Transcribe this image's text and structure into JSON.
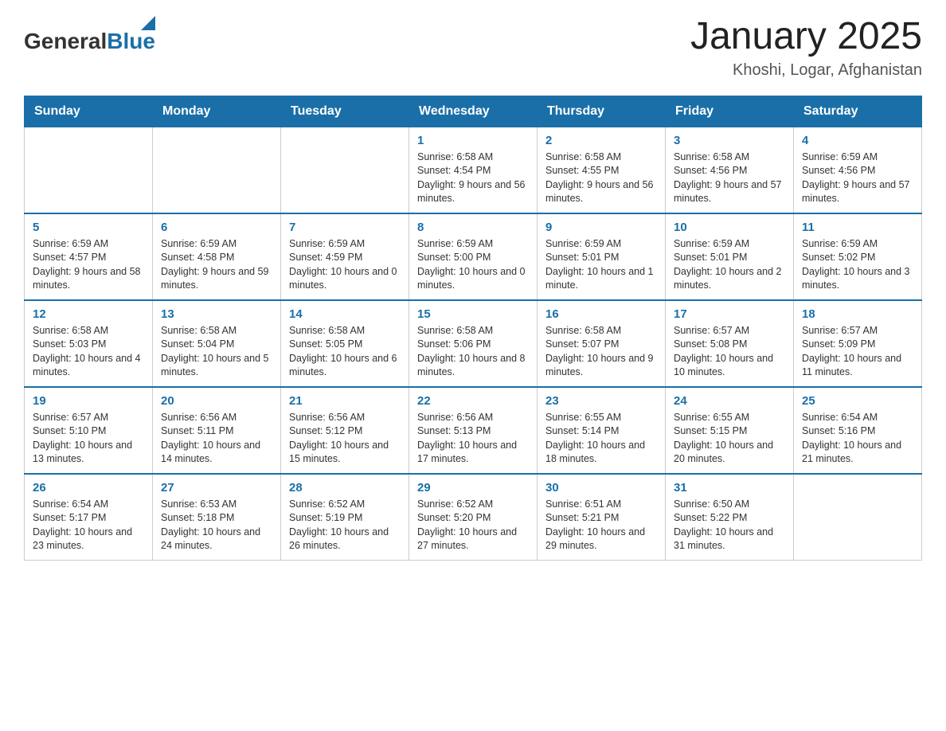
{
  "header": {
    "logo_general": "General",
    "logo_blue": "Blue",
    "title": "January 2025",
    "subtitle": "Khoshi, Logar, Afghanistan"
  },
  "days_of_week": [
    "Sunday",
    "Monday",
    "Tuesday",
    "Wednesday",
    "Thursday",
    "Friday",
    "Saturday"
  ],
  "weeks": [
    [
      {
        "day": "",
        "info": ""
      },
      {
        "day": "",
        "info": ""
      },
      {
        "day": "",
        "info": ""
      },
      {
        "day": "1",
        "info": "Sunrise: 6:58 AM\nSunset: 4:54 PM\nDaylight: 9 hours\nand 56 minutes."
      },
      {
        "day": "2",
        "info": "Sunrise: 6:58 AM\nSunset: 4:55 PM\nDaylight: 9 hours\nand 56 minutes."
      },
      {
        "day": "3",
        "info": "Sunrise: 6:58 AM\nSunset: 4:56 PM\nDaylight: 9 hours\nand 57 minutes."
      },
      {
        "day": "4",
        "info": "Sunrise: 6:59 AM\nSunset: 4:56 PM\nDaylight: 9 hours\nand 57 minutes."
      }
    ],
    [
      {
        "day": "5",
        "info": "Sunrise: 6:59 AM\nSunset: 4:57 PM\nDaylight: 9 hours\nand 58 minutes."
      },
      {
        "day": "6",
        "info": "Sunrise: 6:59 AM\nSunset: 4:58 PM\nDaylight: 9 hours\nand 59 minutes."
      },
      {
        "day": "7",
        "info": "Sunrise: 6:59 AM\nSunset: 4:59 PM\nDaylight: 10 hours\nand 0 minutes."
      },
      {
        "day": "8",
        "info": "Sunrise: 6:59 AM\nSunset: 5:00 PM\nDaylight: 10 hours\nand 0 minutes."
      },
      {
        "day": "9",
        "info": "Sunrise: 6:59 AM\nSunset: 5:01 PM\nDaylight: 10 hours\nand 1 minute."
      },
      {
        "day": "10",
        "info": "Sunrise: 6:59 AM\nSunset: 5:01 PM\nDaylight: 10 hours\nand 2 minutes."
      },
      {
        "day": "11",
        "info": "Sunrise: 6:59 AM\nSunset: 5:02 PM\nDaylight: 10 hours\nand 3 minutes."
      }
    ],
    [
      {
        "day": "12",
        "info": "Sunrise: 6:58 AM\nSunset: 5:03 PM\nDaylight: 10 hours\nand 4 minutes."
      },
      {
        "day": "13",
        "info": "Sunrise: 6:58 AM\nSunset: 5:04 PM\nDaylight: 10 hours\nand 5 minutes."
      },
      {
        "day": "14",
        "info": "Sunrise: 6:58 AM\nSunset: 5:05 PM\nDaylight: 10 hours\nand 6 minutes."
      },
      {
        "day": "15",
        "info": "Sunrise: 6:58 AM\nSunset: 5:06 PM\nDaylight: 10 hours\nand 8 minutes."
      },
      {
        "day": "16",
        "info": "Sunrise: 6:58 AM\nSunset: 5:07 PM\nDaylight: 10 hours\nand 9 minutes."
      },
      {
        "day": "17",
        "info": "Sunrise: 6:57 AM\nSunset: 5:08 PM\nDaylight: 10 hours\nand 10 minutes."
      },
      {
        "day": "18",
        "info": "Sunrise: 6:57 AM\nSunset: 5:09 PM\nDaylight: 10 hours\nand 11 minutes."
      }
    ],
    [
      {
        "day": "19",
        "info": "Sunrise: 6:57 AM\nSunset: 5:10 PM\nDaylight: 10 hours\nand 13 minutes."
      },
      {
        "day": "20",
        "info": "Sunrise: 6:56 AM\nSunset: 5:11 PM\nDaylight: 10 hours\nand 14 minutes."
      },
      {
        "day": "21",
        "info": "Sunrise: 6:56 AM\nSunset: 5:12 PM\nDaylight: 10 hours\nand 15 minutes."
      },
      {
        "day": "22",
        "info": "Sunrise: 6:56 AM\nSunset: 5:13 PM\nDaylight: 10 hours\nand 17 minutes."
      },
      {
        "day": "23",
        "info": "Sunrise: 6:55 AM\nSunset: 5:14 PM\nDaylight: 10 hours\nand 18 minutes."
      },
      {
        "day": "24",
        "info": "Sunrise: 6:55 AM\nSunset: 5:15 PM\nDaylight: 10 hours\nand 20 minutes."
      },
      {
        "day": "25",
        "info": "Sunrise: 6:54 AM\nSunset: 5:16 PM\nDaylight: 10 hours\nand 21 minutes."
      }
    ],
    [
      {
        "day": "26",
        "info": "Sunrise: 6:54 AM\nSunset: 5:17 PM\nDaylight: 10 hours\nand 23 minutes."
      },
      {
        "day": "27",
        "info": "Sunrise: 6:53 AM\nSunset: 5:18 PM\nDaylight: 10 hours\nand 24 minutes."
      },
      {
        "day": "28",
        "info": "Sunrise: 6:52 AM\nSunset: 5:19 PM\nDaylight: 10 hours\nand 26 minutes."
      },
      {
        "day": "29",
        "info": "Sunrise: 6:52 AM\nSunset: 5:20 PM\nDaylight: 10 hours\nand 27 minutes."
      },
      {
        "day": "30",
        "info": "Sunrise: 6:51 AM\nSunset: 5:21 PM\nDaylight: 10 hours\nand 29 minutes."
      },
      {
        "day": "31",
        "info": "Sunrise: 6:50 AM\nSunset: 5:22 PM\nDaylight: 10 hours\nand 31 minutes."
      },
      {
        "day": "",
        "info": ""
      }
    ]
  ]
}
